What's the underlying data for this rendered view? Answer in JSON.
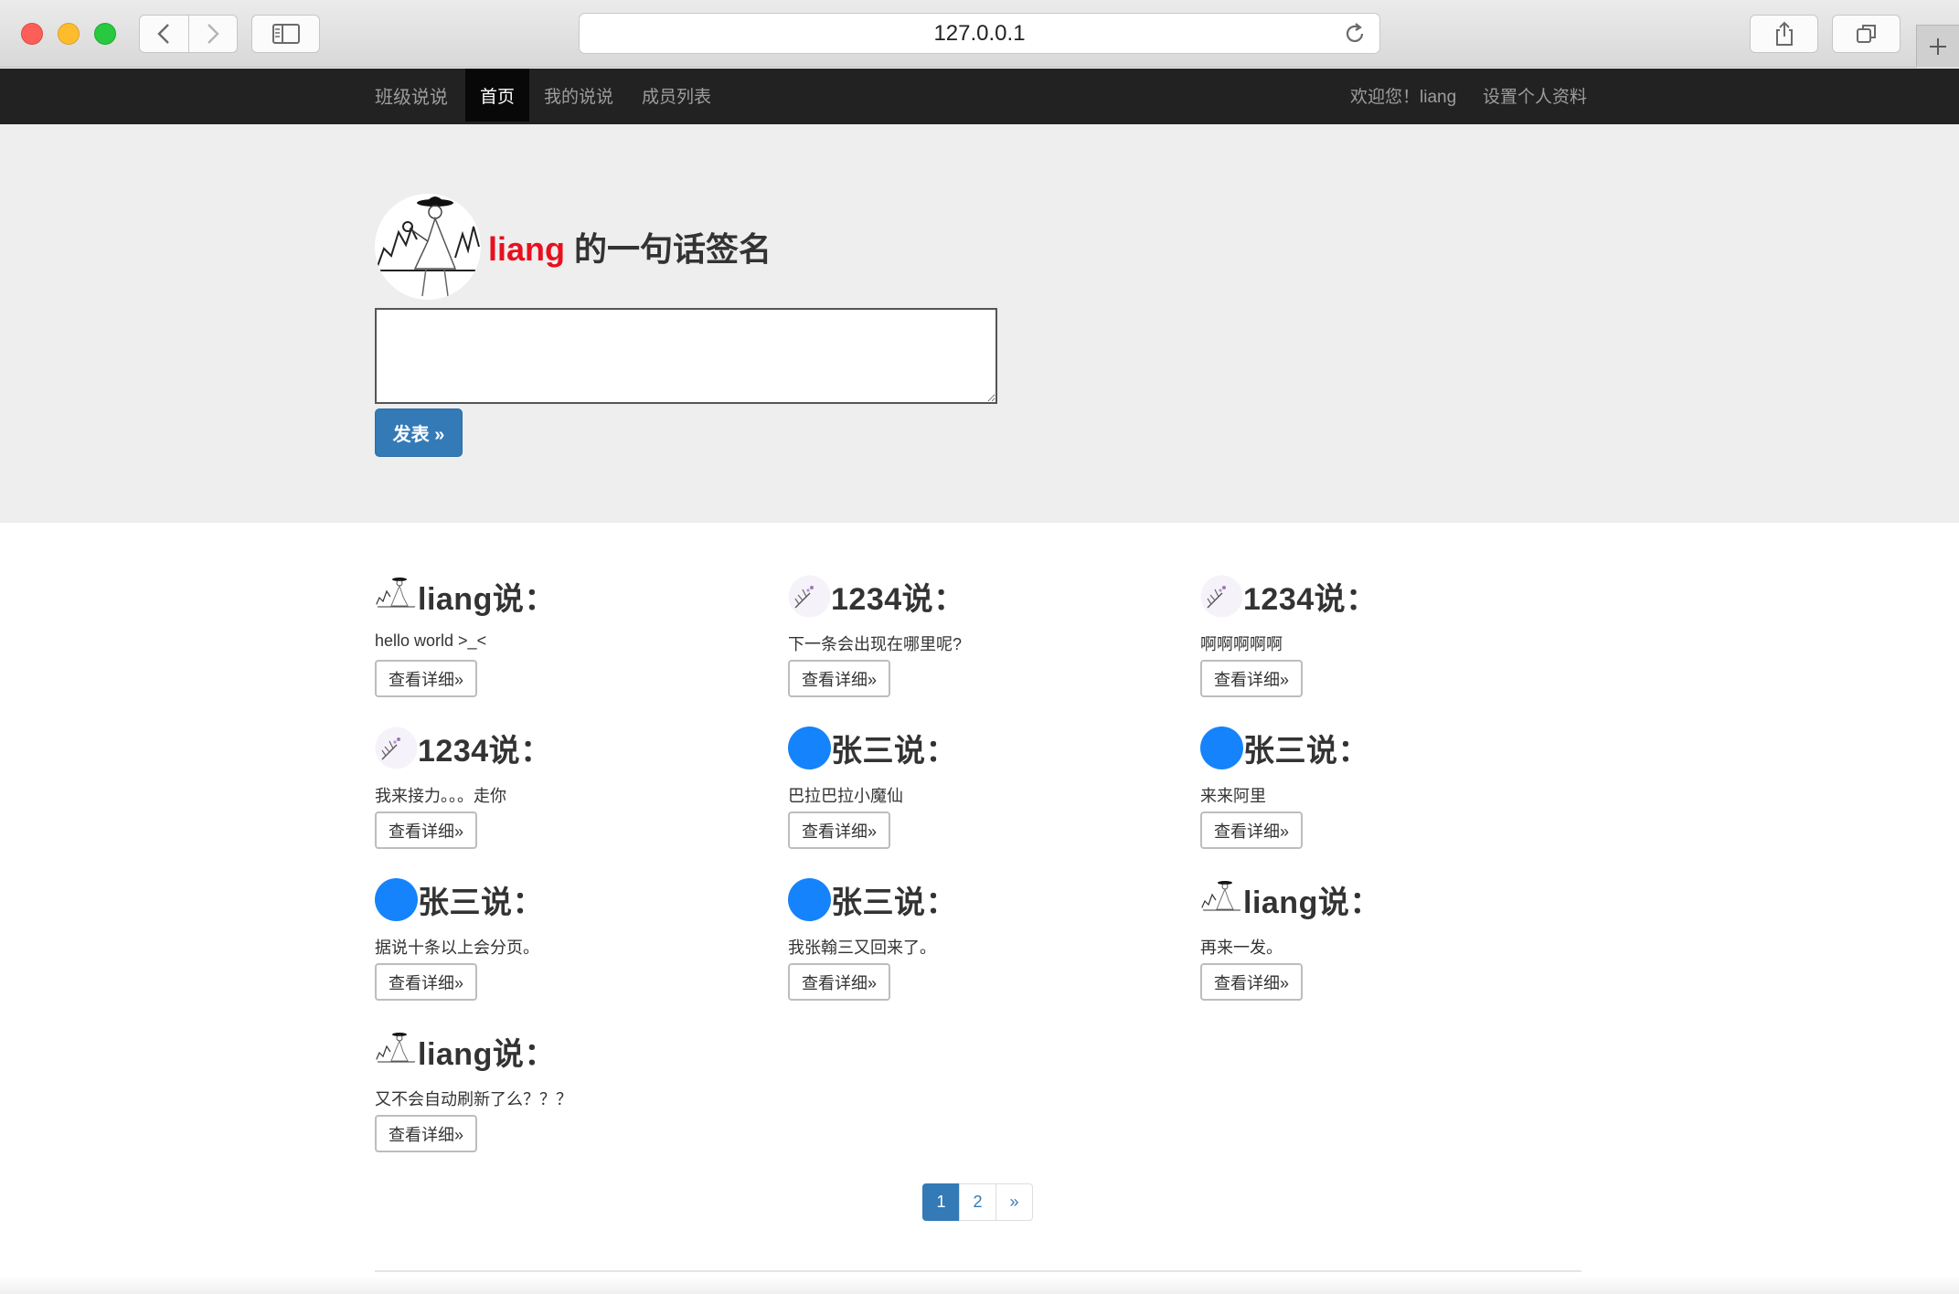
{
  "browser": {
    "url": "127.0.0.1"
  },
  "navbar": {
    "brand": "班级说说",
    "items": [
      {
        "label": "首页",
        "active": true
      },
      {
        "label": "我的说说",
        "active": false
      },
      {
        "label": "成员列表",
        "active": false
      }
    ],
    "welcome": "欢迎您！liang",
    "settings": "设置个人资料"
  },
  "signature": {
    "username": "liang",
    "title_suffix": " 的一句话签名",
    "textarea_value": "",
    "submit_label": "发表 »"
  },
  "posts": [
    {
      "author": "liang说：",
      "avatar": "sketch-avatar-icon",
      "content": "hello world >_<",
      "button": "查看详细»"
    },
    {
      "author": "1234说：",
      "avatar": "flower-avatar-icon",
      "content": "下一条会出现在哪里呢?",
      "button": "查看详细»"
    },
    {
      "author": "1234说：",
      "avatar": "flower-avatar-icon",
      "content": "啊啊啊啊啊",
      "button": "查看详细»"
    },
    {
      "author": "1234说：",
      "avatar": "flower-avatar-icon",
      "content": "我来接力。。。走你",
      "button": "查看详细»"
    },
    {
      "author": "张三说：",
      "avatar": "blue-circle-avatar-icon",
      "content": "巴拉巴拉小魔仙",
      "button": "查看详细»"
    },
    {
      "author": "张三说：",
      "avatar": "blue-circle-avatar-icon",
      "content": "来来阿里",
      "button": "查看详细»"
    },
    {
      "author": "张三说：",
      "avatar": "blue-circle-avatar-icon",
      "content": "据说十条以上会分页。",
      "button": "查看详细»"
    },
    {
      "author": "张三说：",
      "avatar": "blue-circle-avatar-icon",
      "content": "我张翰三又回来了。",
      "button": "查看详细»"
    },
    {
      "author": "liang说：",
      "avatar": "sketch-avatar-icon",
      "content": "再来一发。",
      "button": "查看详细»"
    },
    {
      "author": "liang说：",
      "avatar": "sketch-avatar-icon",
      "content": "又不会自动刷新了么？？？",
      "button": "查看详细»"
    }
  ],
  "pagination": {
    "pages": [
      "1",
      "2"
    ],
    "current": "1",
    "next_label": "»"
  },
  "colors": {
    "navbar_bg": "#222222",
    "jumbotron_bg": "#eeeeee",
    "primary": "#337ab7",
    "username_red": "#e8101f",
    "avatar_blue": "#1583fb"
  }
}
